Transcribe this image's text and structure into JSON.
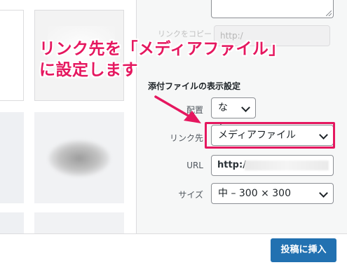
{
  "annotation": {
    "line1": "リンク先を「メディアファイル」",
    "line2": "に設定します"
  },
  "attachment": {
    "copy_label": "リンクをコピー",
    "copy_value": "http:/"
  },
  "display_settings": {
    "title": "添付ファイルの表示設定",
    "align_label": "配置",
    "align_value": "なし",
    "link_label": "リンク先",
    "link_value": "メディアファイル",
    "url_label": "URL",
    "url_value": "http:/",
    "size_label": "サイズ",
    "size_value": "中 – 300 × 300"
  },
  "toolbar": {
    "insert_label": "投稿に挿入"
  },
  "colors": {
    "accent": "#e5175f",
    "primary_button": "#2271b1"
  },
  "icons": [
    "chevron-down-icon",
    "resize-handle-icon",
    "arrow-annotation-icon"
  ]
}
